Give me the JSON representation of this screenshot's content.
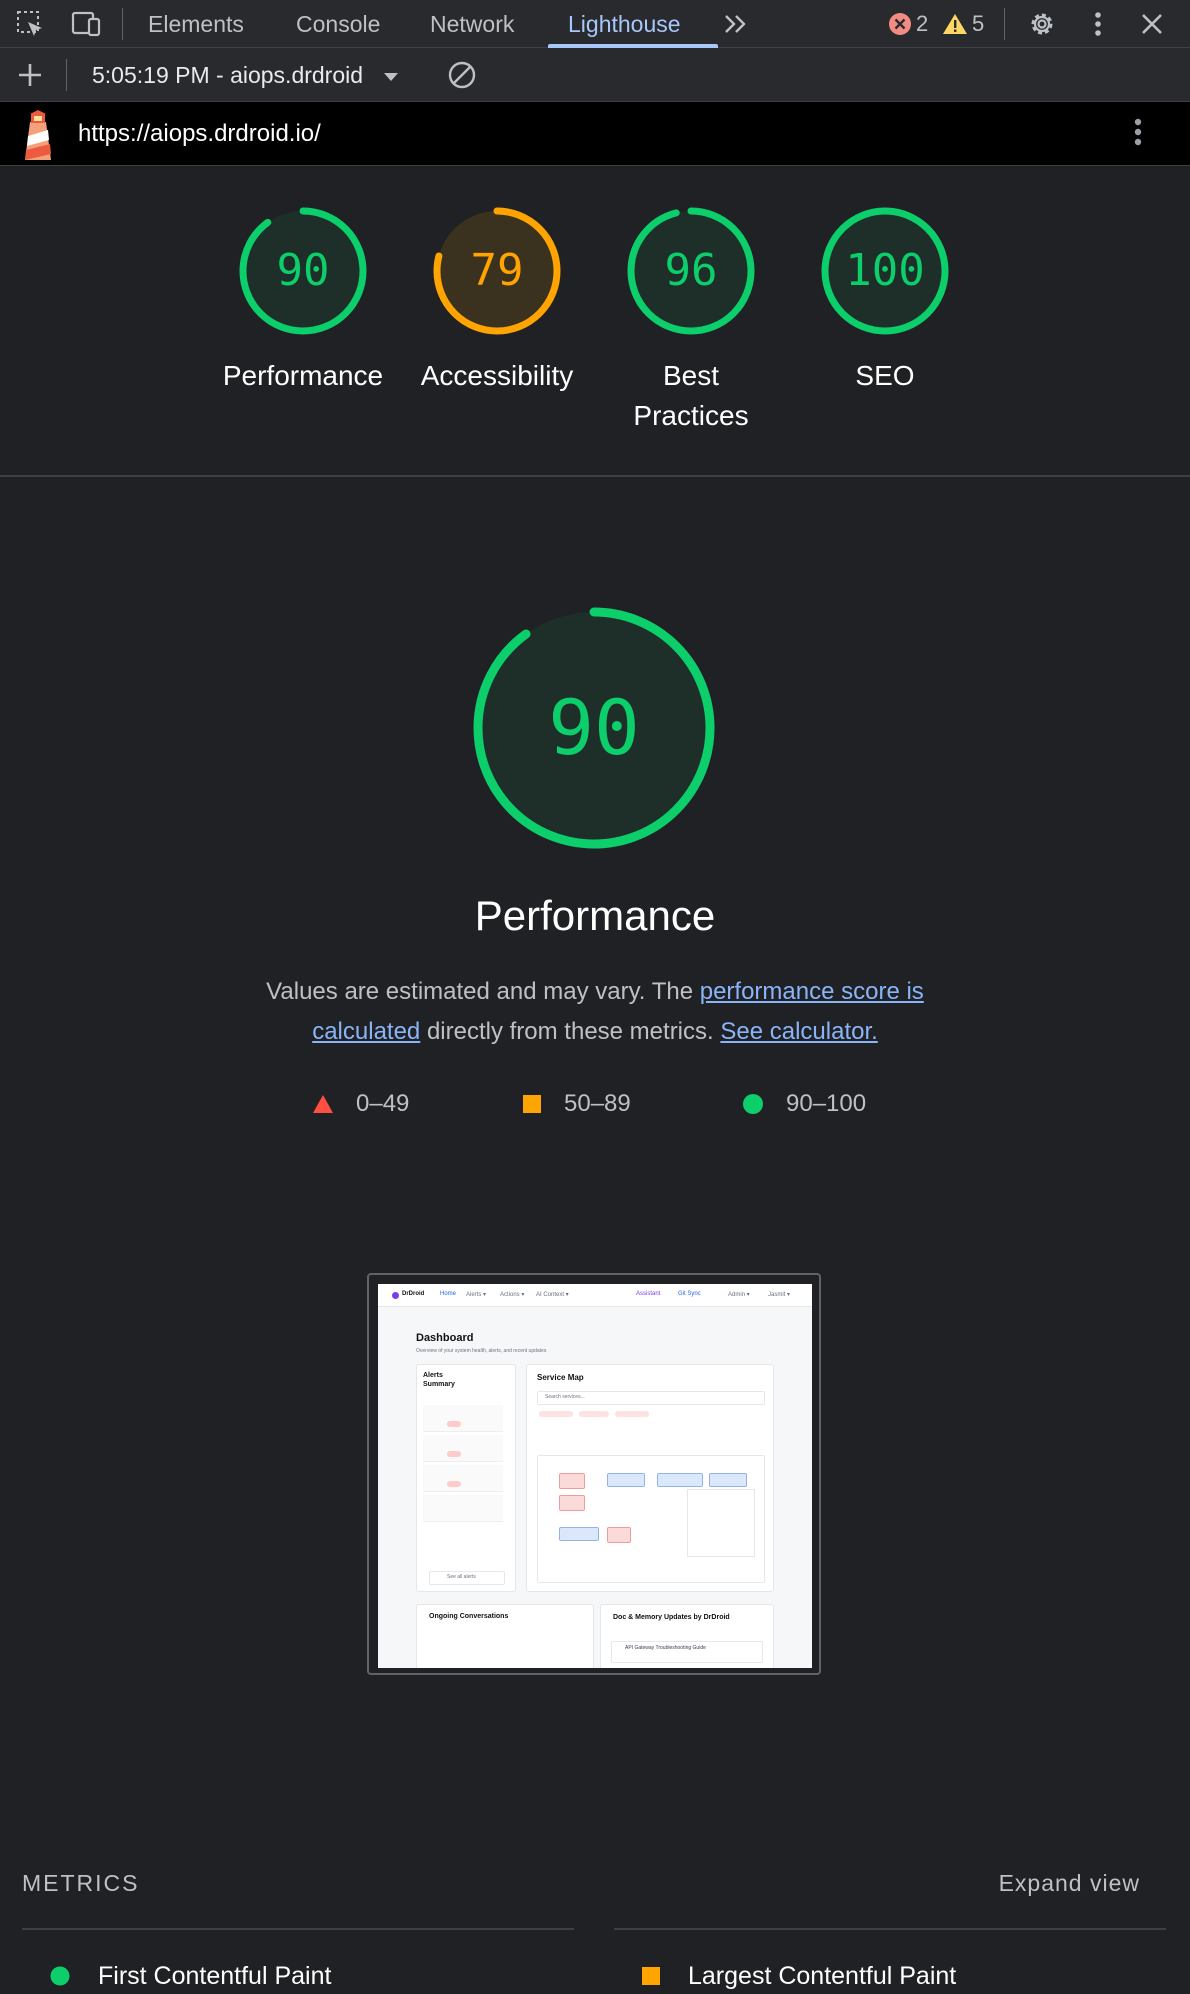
{
  "devtools": {
    "tabs": [
      "Elements",
      "Console",
      "Network",
      "Lighthouse"
    ],
    "active_tab": "Lighthouse",
    "more_tabs_icon": "double-chevron-right-icon",
    "error_count": "2",
    "warning_count": "5"
  },
  "report_bar": {
    "selected_report": "5:05:19 PM - aiops.drdroid"
  },
  "url_bar": {
    "url": "https://aiops.drdroid.io/"
  },
  "scores": [
    {
      "label": "Performance",
      "value": "90",
      "score": 90,
      "color": "#0cce6b"
    },
    {
      "label": "Accessibility",
      "value": "79",
      "score": 79,
      "color": "#ffa400"
    },
    {
      "label": "Best Practices",
      "value": "96",
      "score": 96,
      "color": "#0cce6b"
    },
    {
      "label": "SEO",
      "value": "100",
      "score": 100,
      "color": "#0cce6b"
    }
  ],
  "category": {
    "score": "90",
    "score_value": 90,
    "title": "Performance",
    "desc_part1": "Values are estimated and may vary. The ",
    "desc_link1": "performance score is calculated",
    "desc_part2": " directly from these metrics. ",
    "desc_link2": "See calculator."
  },
  "legend": [
    {
      "range": "0–49",
      "shape": "triangle",
      "color": "#ff4e42"
    },
    {
      "range": "50–89",
      "shape": "square",
      "color": "#ffa400"
    },
    {
      "range": "90–100",
      "shape": "circle",
      "color": "#0cce6b"
    }
  ],
  "thumbnail": {
    "brand": "DrDroid",
    "nav": [
      "Home",
      "Alerts ▾",
      "Actions ▾",
      "AI Context ▾"
    ],
    "nav_right": [
      "Assistant",
      "Git Sync",
      "Admin ▾",
      "Jasmit ▾"
    ],
    "heading": "Dashboard",
    "subheading": "Overview of your system health, alerts, and recent updates",
    "alerts_title": "Alerts Summary",
    "service_map_title": "Service Map",
    "search_placeholder": "Search services...",
    "see_all": "See all alerts",
    "conversations_title": "Ongoing Conversations",
    "docs_title": "Doc & Memory Updates by DrDroid",
    "doc_item": "API Gateway Troubleshooting Guide"
  },
  "metrics": {
    "section_title": "METRICS",
    "expand_label": "Expand view",
    "items": [
      {
        "label": "First Contentful Paint",
        "rating": "pass",
        "color": "#0cce6b"
      },
      {
        "label": "Largest Contentful Paint",
        "rating": "average",
        "color": "#ffa400"
      }
    ]
  }
}
